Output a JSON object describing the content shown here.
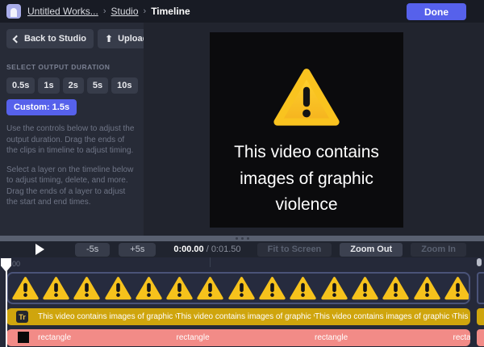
{
  "topbar": {
    "breadcrumb": [
      "Untitled Works...",
      "Studio",
      "Timeline"
    ],
    "separator": "›",
    "done_label": "Done"
  },
  "sidebar": {
    "back_label": "Back to Studio",
    "upload_label": "Upload",
    "upload_glyph": "⬆",
    "duration_heading": "SELECT OUTPUT DURATION",
    "duration_options": [
      "0.5s",
      "1s",
      "2s",
      "5s",
      "10s"
    ],
    "custom_label": "Custom: 1.5s",
    "help_p1": "Use the controls below to adjust the output duration. Drag the ends of the clips in timeline to adjust timing.",
    "help_p2": "Select a layer on the timeline below to adjust timing, delete, and more. Drag the ends of a layer to adjust the start and end times."
  },
  "canvas": {
    "warning_caption": "This video contains images of graphic violence"
  },
  "playbar": {
    "minus_label": "-5s",
    "plus_label": "+5s",
    "current_time": "0:00.00",
    "total_time": "/ 0:01.50",
    "fit_label": "Fit to Screen",
    "zoom_out_label": "Zoom Out",
    "zoom_in_label": "Zoom In"
  },
  "timeline": {
    "ruler_start_label": "00",
    "text_track_icon": "Tr",
    "text_track_label": "This video contains images of graphic violen...",
    "shape_track_label": "rectangle"
  },
  "colors": {
    "accent": "#5661eb",
    "warning_yellow": "#ffc81e",
    "text_track_gold": "#cfa50d",
    "shape_track_pink": "#f28b87"
  }
}
